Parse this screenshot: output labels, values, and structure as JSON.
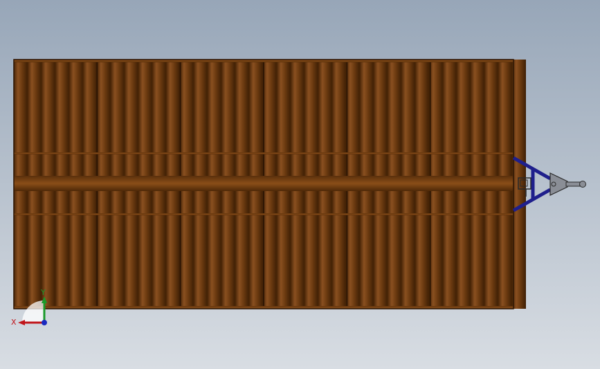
{
  "viewport": {
    "background_top": "#97a6b8",
    "background_bottom": "#d8dde3"
  },
  "model": {
    "body_color": "#6b3a10",
    "body_shadow": "#4a2608",
    "band_color": "#7a4414",
    "frame_color": "#1f1f8c",
    "hitch_color": "#8a8e96",
    "hitch_outline": "#2a2a2a",
    "panel_count": 6
  },
  "triad": {
    "x_label": "X",
    "y_label": "Y",
    "x_color": "#c0141a",
    "y_color": "#1a9a2a",
    "z_color": "#1a2ac0"
  }
}
